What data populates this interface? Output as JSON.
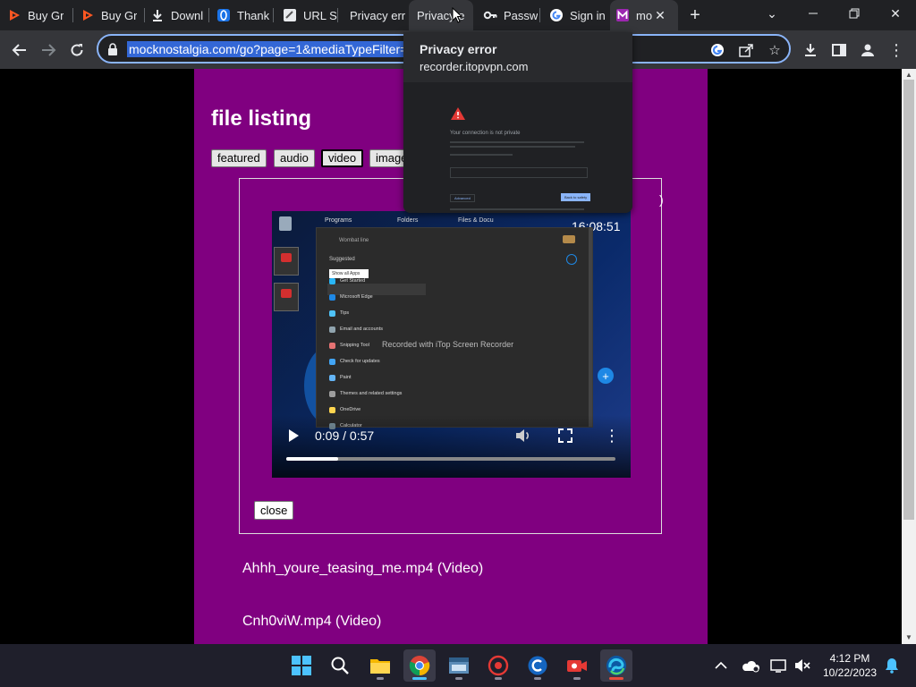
{
  "browser": {
    "tabs": [
      {
        "label": "Buy Gr",
        "icon": "play-icon"
      },
      {
        "label": "Buy Gr",
        "icon": "play-icon"
      },
      {
        "label": "Downl",
        "icon": "download-icon"
      },
      {
        "label": "Thank",
        "icon": "blue-o-icon"
      },
      {
        "label": "URL Sh",
        "icon": "page-icon"
      },
      {
        "label": "Privacy erro",
        "icon": "warning-icon"
      },
      {
        "label": "Privacy e",
        "icon": "warning-icon"
      },
      {
        "label": "Passw",
        "icon": "key-icon"
      },
      {
        "label": "Sign in",
        "icon": "google-icon"
      },
      {
        "label": "mo",
        "icon": "m-icon"
      }
    ],
    "url": "mocknostalgia.com/go?page=1&mediaTypeFilter="
  },
  "hovercard": {
    "title": "Privacy error",
    "domain": "recorder.itopvpn.com",
    "thumb_heading": "Your connection is not private",
    "thumb_btn_left": "Advanced",
    "thumb_btn_right": "Back to safety"
  },
  "page": {
    "title": "file listing",
    "filters": [
      "featured",
      "audio",
      "video",
      "image"
    ],
    "selected_filter": "video",
    "player": {
      "time": "0:09 / 0:57",
      "progress": 0.158,
      "watermark": "Recorded with iTop Screen Recorder",
      "clock": "16:08:51",
      "taskbar_labels": [
        "Programs",
        "Folders",
        "Files & Docu"
      ],
      "search_hint": "Wombat line",
      "suggested": "Suggested",
      "tooltip": "Show all Apps",
      "menu": [
        "Get Started",
        "Microsoft Edge",
        "Tips",
        "Email and accounts",
        "Snipping Tool",
        "Check for updates",
        "Paint",
        "Themes and related settings",
        "OneDrive",
        "Calculator"
      ]
    },
    "close_label": "close",
    "files": [
      "Ahhh_youre_teasing_me.mp4 (Video)",
      "Cnh0viW.mp4 (Video)"
    ]
  },
  "taskbar": {
    "time": "4:12 PM",
    "date": "10/22/2023"
  },
  "colors": {
    "page_bg": "#800080",
    "chrome_dark": "#202124",
    "toolbar": "#35363a",
    "focus_ring": "#8ab4f8"
  }
}
